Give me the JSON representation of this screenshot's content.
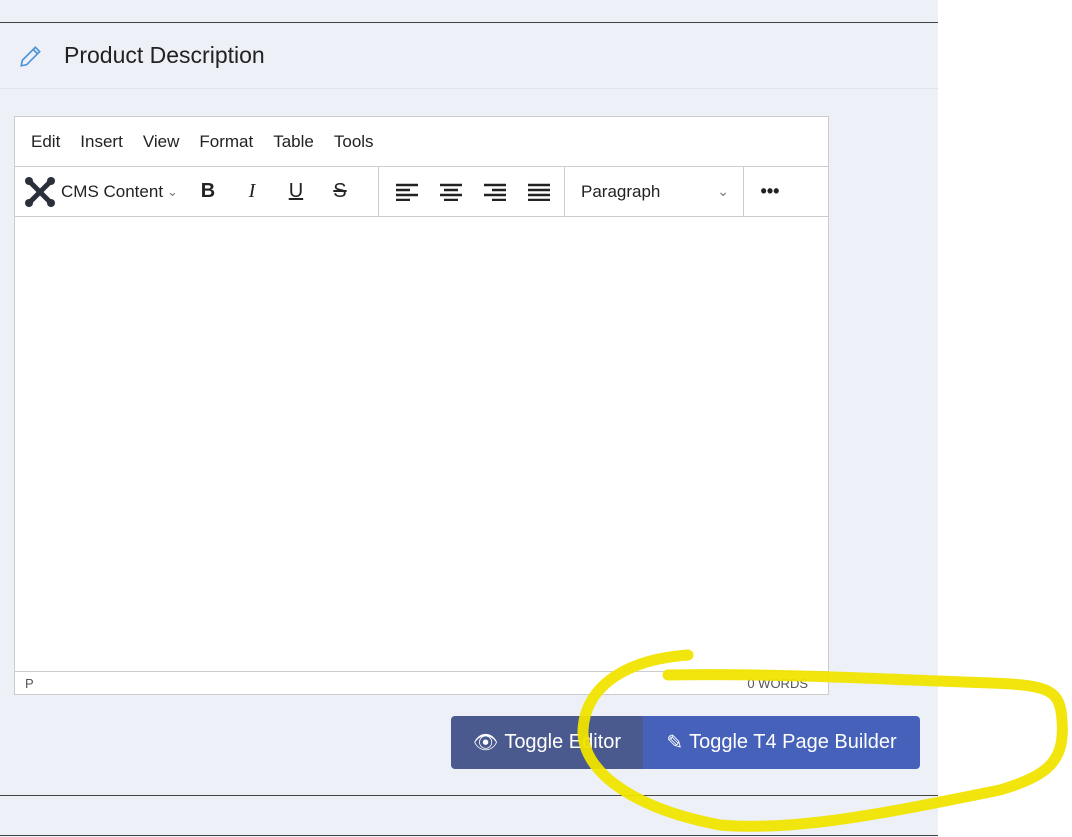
{
  "section": {
    "title": "Product Description",
    "icon": "pencil-icon"
  },
  "editor": {
    "menu": [
      "Edit",
      "Insert",
      "View",
      "Format",
      "Table",
      "Tools"
    ],
    "cms_content": "CMS Content",
    "format_select": "Paragraph",
    "status_path": "P",
    "word_count": "0 WORDS"
  },
  "buttons": {
    "toggle_editor": "Toggle Editor",
    "toggle_builder": "Toggle T4 Page Builder"
  },
  "colors": {
    "toggle_editor": "#4a5a8e",
    "toggle_builder": "#4661b9",
    "annotation": "#f0e400"
  }
}
